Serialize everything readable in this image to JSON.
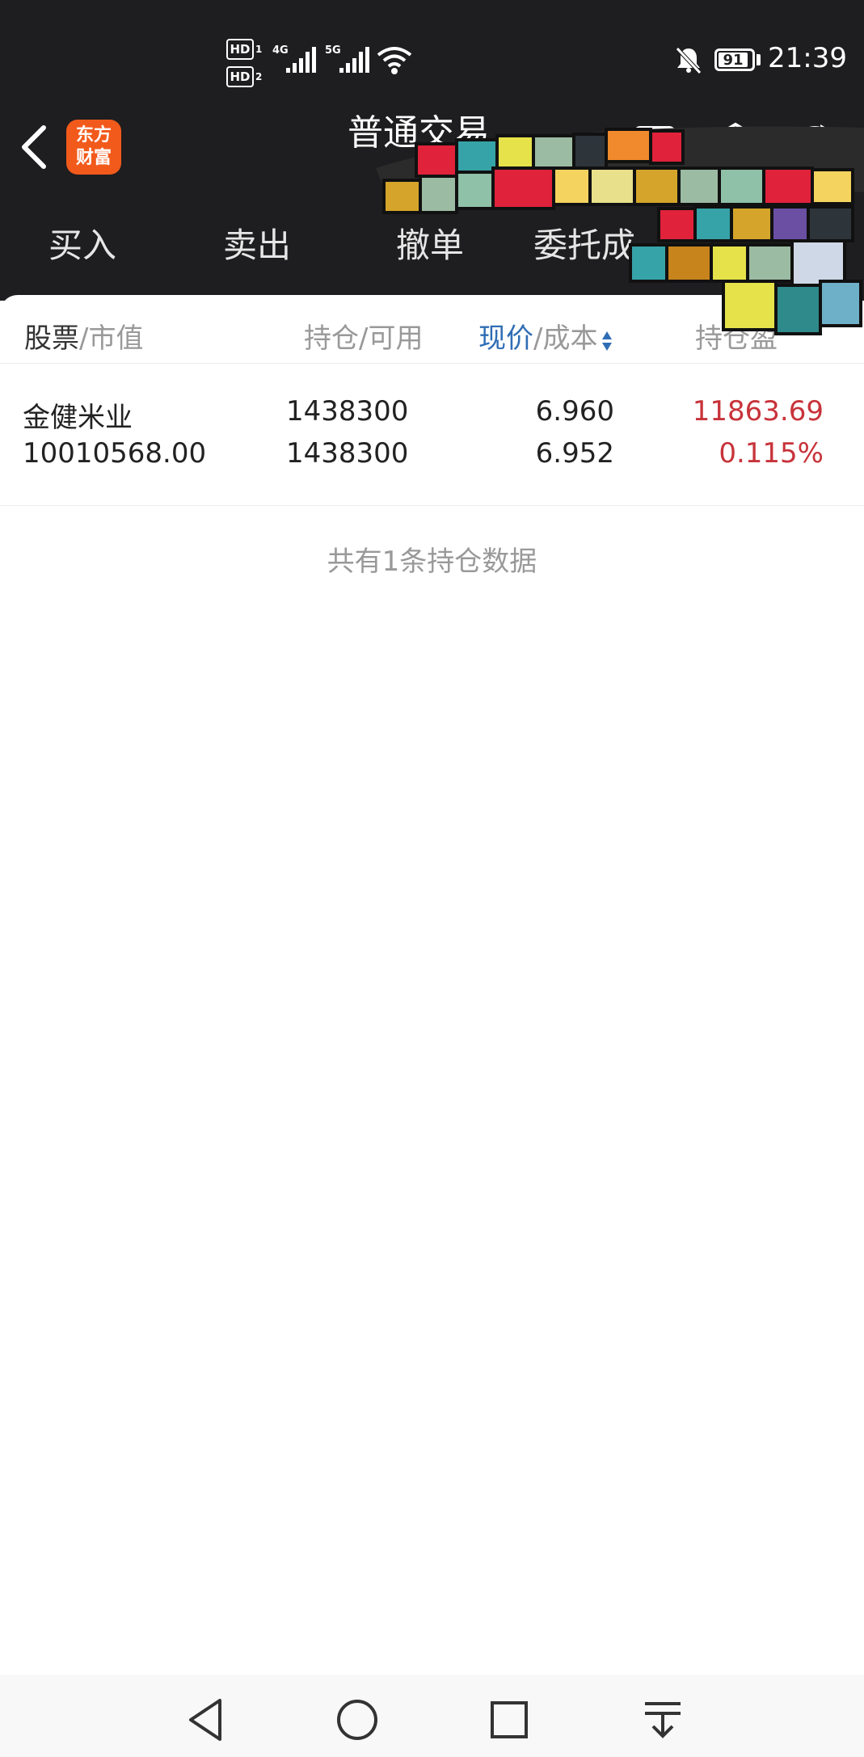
{
  "status_bar": {
    "sim1": "HD",
    "sim1_sub": "1",
    "sim2": "HD",
    "sim2_sub": "2",
    "net1": "4G",
    "net2": "5G",
    "battery": "91",
    "time": "21:39"
  },
  "header": {
    "logo_line1": "东方",
    "logo_line2": "财富",
    "title": "普通交易"
  },
  "tabs": [
    {
      "label": "买入"
    },
    {
      "label": "卖出"
    },
    {
      "label": "撤单"
    },
    {
      "label": "委托成"
    }
  ],
  "table": {
    "headers": {
      "stock": "股票",
      "market_value": "/市值",
      "position": "持仓/可用",
      "price": "现价",
      "cost": "/成本",
      "pnl": "持仓盈"
    },
    "rows": [
      {
        "name": "金健米业",
        "market_value": "10010568.00",
        "position": "1438300",
        "available": "1438300",
        "price": "6.960",
        "cost": "6.952",
        "pnl": "11863.69",
        "pnl_pct": "0.115%"
      }
    ],
    "footer": "共有1条持仓数据"
  },
  "colors": {
    "dark_bg": "#1e1e20",
    "brand": "#f25a1b",
    "accent_blue": "#2f6db5",
    "profit_red": "#c8333a"
  },
  "icons": [
    "back-icon",
    "scan-icon",
    "settings-icon",
    "refresh-icon",
    "nav-back-icon",
    "nav-home-icon",
    "nav-recent-icon",
    "nav-notification-icon"
  ]
}
